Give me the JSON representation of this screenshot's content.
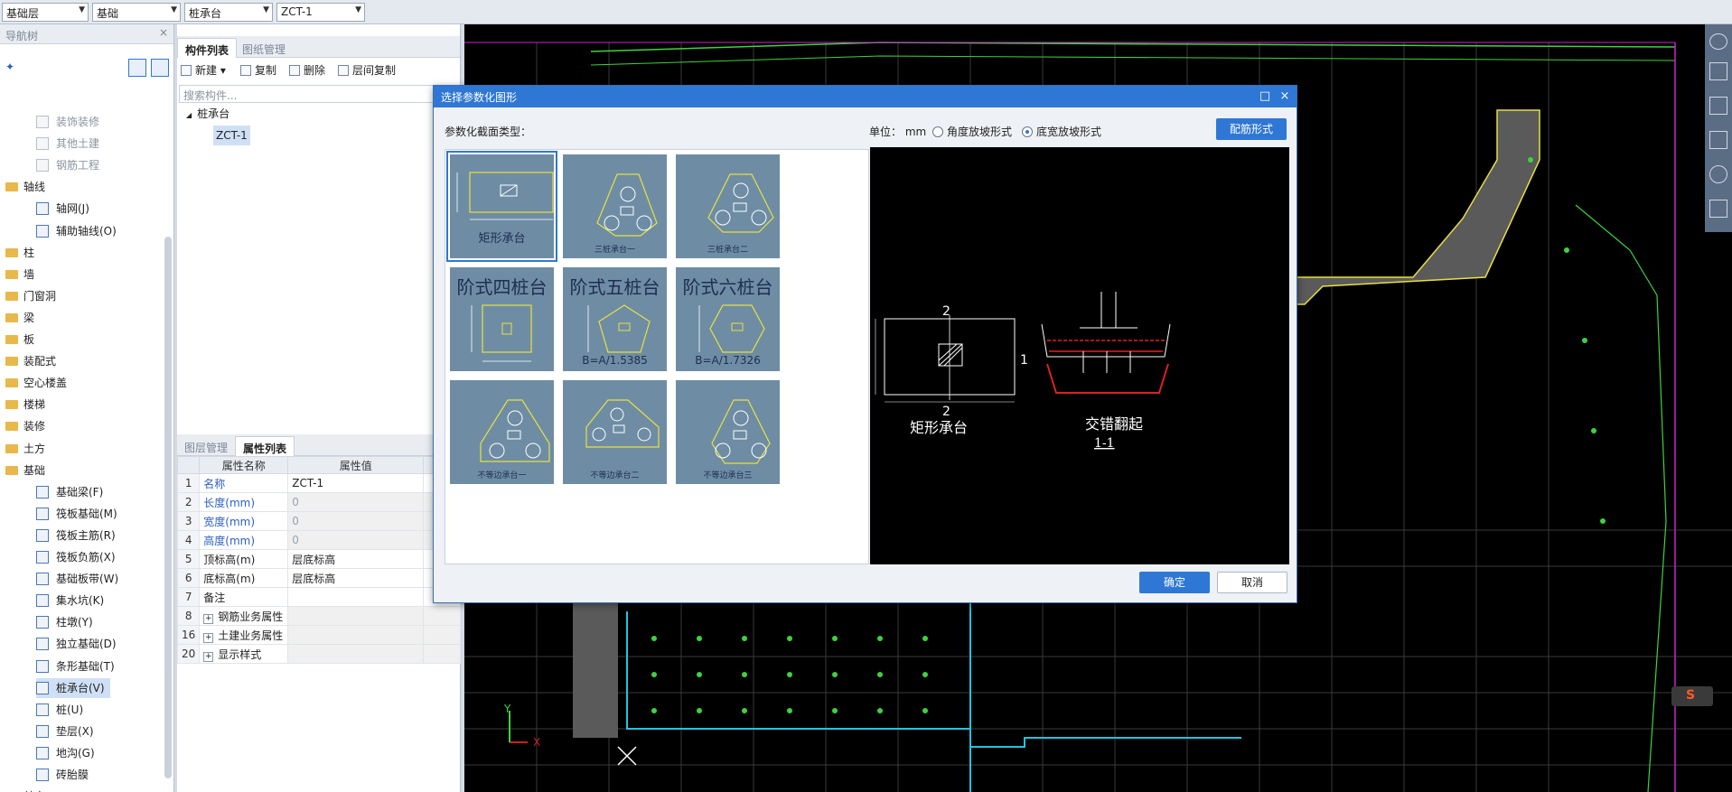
{
  "topbar": {
    "combos": [
      "基础层",
      "基础",
      "桩承台",
      "ZCT-1"
    ]
  },
  "nav": {
    "title": "导航树",
    "items": [
      {
        "label": "装饰装修",
        "kind": "child",
        "dim": true
      },
      {
        "label": "其他土建",
        "kind": "child",
        "dim": true
      },
      {
        "label": "钢筋工程",
        "kind": "child",
        "dim": true
      },
      {
        "label": "轴线",
        "kind": "folder"
      },
      {
        "label": "轴网(J)",
        "kind": "child"
      },
      {
        "label": "辅助轴线(O)",
        "kind": "child"
      },
      {
        "label": "柱",
        "kind": "folder"
      },
      {
        "label": "墙",
        "kind": "folder"
      },
      {
        "label": "门窗洞",
        "kind": "folder"
      },
      {
        "label": "梁",
        "kind": "folder"
      },
      {
        "label": "板",
        "kind": "folder"
      },
      {
        "label": "装配式",
        "kind": "folder"
      },
      {
        "label": "空心楼盖",
        "kind": "folder"
      },
      {
        "label": "楼梯",
        "kind": "folder"
      },
      {
        "label": "装修",
        "kind": "folder"
      },
      {
        "label": "土方",
        "kind": "folder"
      },
      {
        "label": "基础",
        "kind": "folder"
      },
      {
        "label": "基础梁(F)",
        "kind": "child"
      },
      {
        "label": "筏板基础(M)",
        "kind": "child"
      },
      {
        "label": "筏板主筋(R)",
        "kind": "child"
      },
      {
        "label": "筏板负筋(X)",
        "kind": "child"
      },
      {
        "label": "基础板带(W)",
        "kind": "child"
      },
      {
        "label": "集水坑(K)",
        "kind": "child"
      },
      {
        "label": "柱墩(Y)",
        "kind": "child"
      },
      {
        "label": "独立基础(D)",
        "kind": "child"
      },
      {
        "label": "条形基础(T)",
        "kind": "child"
      },
      {
        "label": "桩承台(V)",
        "kind": "child",
        "selected": true
      },
      {
        "label": "桩(U)",
        "kind": "child"
      },
      {
        "label": "垫层(X)",
        "kind": "child"
      },
      {
        "label": "地沟(G)",
        "kind": "child"
      },
      {
        "label": "砖胎膜",
        "kind": "child"
      },
      {
        "label": "其它",
        "kind": "folder"
      }
    ]
  },
  "components": {
    "tabs": [
      "构件列表",
      "图纸管理"
    ],
    "toolbar": {
      "new": "新建",
      "copy": "复制",
      "delete": "删除",
      "floor_copy": "层间复制"
    },
    "search_placeholder": "搜索构件...",
    "tree_root": "桩承台",
    "tree_child": "ZCT-1"
  },
  "properties": {
    "tabs": [
      "图层管理",
      "属性列表"
    ],
    "headers": [
      "属性名称",
      "属性值"
    ],
    "rows": [
      {
        "num": "1",
        "name": "名称",
        "value": "ZCT-1",
        "blue": true,
        "gray": false
      },
      {
        "num": "2",
        "name": "长度(mm)",
        "value": "0",
        "blue": true,
        "gray": true
      },
      {
        "num": "3",
        "name": "宽度(mm)",
        "value": "0",
        "blue": true,
        "gray": true
      },
      {
        "num": "4",
        "name": "高度(mm)",
        "value": "0",
        "blue": true,
        "gray": true
      },
      {
        "num": "5",
        "name": "顶标高(m)",
        "value": "层底标高",
        "blue": false,
        "gray": false
      },
      {
        "num": "6",
        "name": "底标高(m)",
        "value": "层底标高",
        "blue": false,
        "gray": false
      },
      {
        "num": "7",
        "name": "备注",
        "value": "",
        "blue": false,
        "gray": false
      },
      {
        "num": "8",
        "name": "钢筋业务属性",
        "value": "",
        "blue": false,
        "gray": true,
        "expand": true
      },
      {
        "num": "16",
        "name": "土建业务属性",
        "value": "",
        "blue": false,
        "gray": true,
        "expand": true
      },
      {
        "num": "20",
        "name": "显示样式",
        "value": "",
        "blue": false,
        "gray": true,
        "expand": true
      }
    ]
  },
  "dialog": {
    "title": "选择参数化图形",
    "section_label": "参数化截面类型：",
    "unit_label": "单位：",
    "unit_value": "mm",
    "radio1": "角度放坡形式",
    "radio2": "底宽放坡形式",
    "rebar_button": "配筋形式",
    "ok": "确定",
    "cancel": "取消",
    "thumbs": [
      {
        "caption": "矩形承台",
        "big": ""
      },
      {
        "caption": "三桩承台一",
        "big": ""
      },
      {
        "caption": "三桩承台二",
        "big": ""
      },
      {
        "caption": "",
        "big": "阶式四桩台"
      },
      {
        "caption": "B=A/1.5385",
        "big": "阶式五桩台"
      },
      {
        "caption": "B=A/1.7326",
        "big": "阶式六桩台"
      },
      {
        "caption": "不等边承台一",
        "big": ""
      },
      {
        "caption": "不等边承台二",
        "big": ""
      },
      {
        "caption": "不等边承台三",
        "big": ""
      }
    ],
    "preview": {
      "left_caption": "矩形承台",
      "right_caption": "交错翻起",
      "section_label": "1-1",
      "mark_top": "2",
      "mark_bottom": "2",
      "mark_right": "1"
    }
  },
  "cad": {
    "axis_y": "Y",
    "axis_x": "X"
  },
  "colors": {
    "accent": "#2f77d4",
    "cad_bg": "#000000",
    "thumb_bg": "#6e8da4"
  }
}
